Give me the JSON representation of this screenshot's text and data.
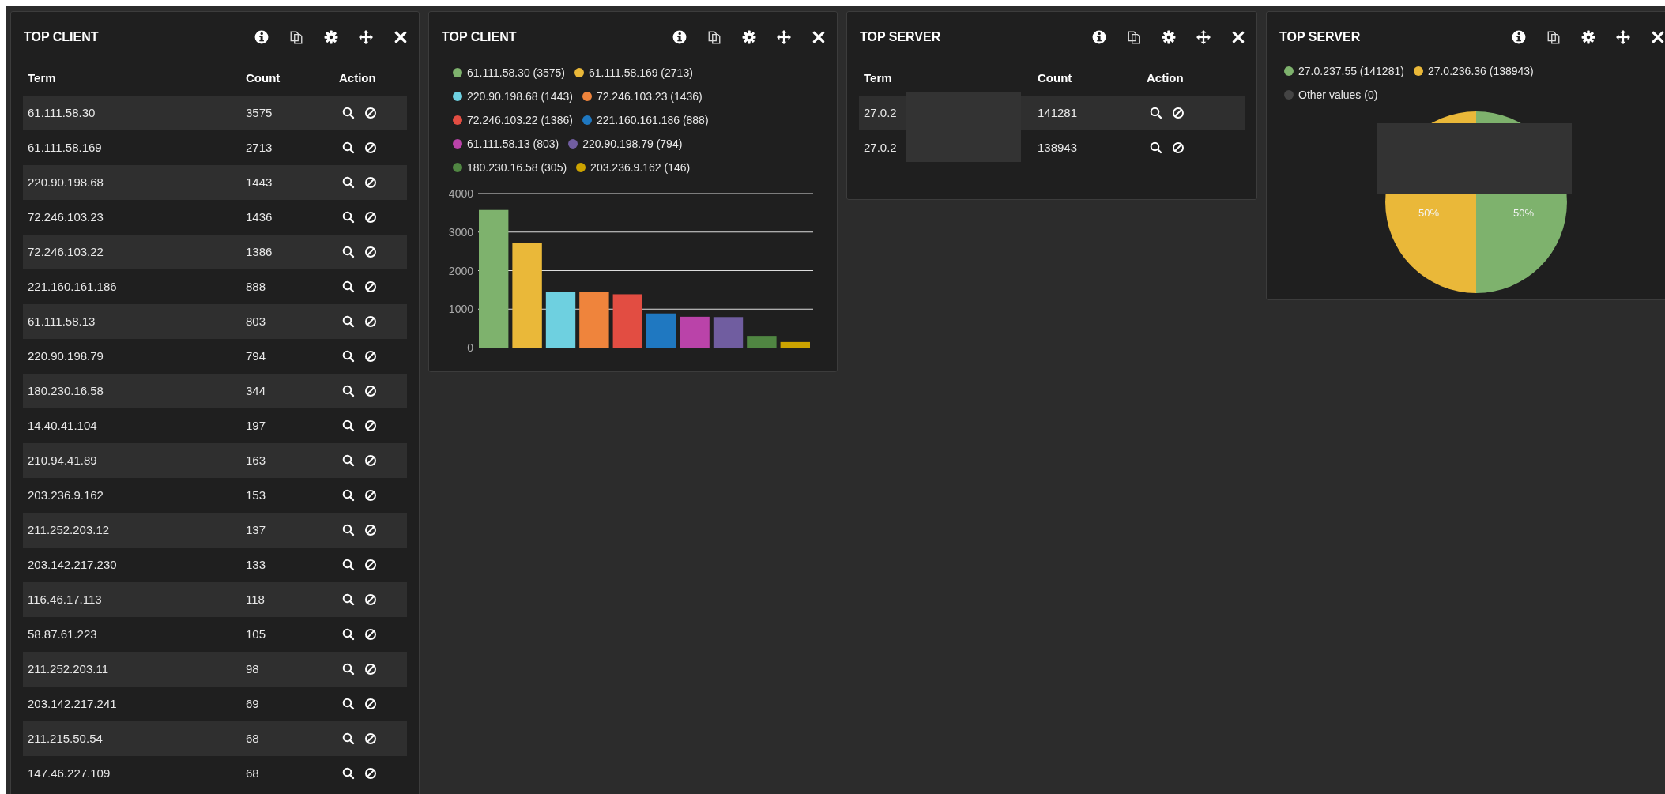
{
  "panels": [
    {
      "kind": "table",
      "title": "TOP CLIENT",
      "columns": [
        "Term",
        "Count",
        "Action"
      ],
      "rows": [
        {
          "term": "61.111.58.30",
          "count": "3575"
        },
        {
          "term": "61.111.58.169",
          "count": "2713"
        },
        {
          "term": "220.90.198.68",
          "count": "1443"
        },
        {
          "term": "72.246.103.23",
          "count": "1436"
        },
        {
          "term": "72.246.103.22",
          "count": "1386"
        },
        {
          "term": "221.160.161.186",
          "count": "888"
        },
        {
          "term": "61.111.58.13",
          "count": "803"
        },
        {
          "term": "220.90.198.79",
          "count": "794"
        },
        {
          "term": "180.230.16.58",
          "count": "344"
        },
        {
          "term": "14.40.41.104",
          "count": "197"
        },
        {
          "term": "210.94.41.89",
          "count": "163"
        },
        {
          "term": "203.236.9.162",
          "count": "153"
        },
        {
          "term": "211.252.203.12",
          "count": "137"
        },
        {
          "term": "203.142.217.230",
          "count": "133"
        },
        {
          "term": "116.46.17.113",
          "count": "118"
        },
        {
          "term": "58.87.61.223",
          "count": "105"
        },
        {
          "term": "211.252.203.11",
          "count": "98"
        },
        {
          "term": "203.142.217.241",
          "count": "69"
        },
        {
          "term": "211.215.50.54",
          "count": "68"
        },
        {
          "term": "147.46.227.109",
          "count": "68"
        }
      ]
    },
    {
      "kind": "chart",
      "title": "TOP CLIENT",
      "legend": [
        {
          "label": "61.111.58.30 (3575)",
          "color": "#7eb26d"
        },
        {
          "label": "61.111.58.169 (2713)",
          "color": "#eab839"
        },
        {
          "label": "220.90.198.68 (1443)",
          "color": "#6ed0e0"
        },
        {
          "label": "72.246.103.23 (1436)",
          "color": "#ef843c"
        },
        {
          "label": "72.246.103.22 (1386)",
          "color": "#e24d42"
        },
        {
          "label": "221.160.161.186 (888)",
          "color": "#1f78c1"
        },
        {
          "label": "61.111.58.13 (803)",
          "color": "#ba43a9"
        },
        {
          "label": "220.90.198.79 (794)",
          "color": "#705da0"
        },
        {
          "label": "180.230.16.58 (305)",
          "color": "#508642"
        },
        {
          "label": "203.236.9.162 (146)",
          "color": "#cca300"
        }
      ],
      "chart_data": {
        "type": "bar",
        "values": [
          3575,
          2713,
          1443,
          1436,
          1386,
          888,
          803,
          794,
          305,
          146
        ],
        "ylim": [
          0,
          4000
        ],
        "yticks": [
          0,
          1000,
          2000,
          3000,
          4000
        ],
        "grid": true
      }
    },
    {
      "kind": "table",
      "title": "TOP SERVER",
      "columns": [
        "Term",
        "Count",
        "Action"
      ],
      "rows": [
        {
          "term": "27.0.2",
          "count": "141281",
          "redacted": true
        },
        {
          "term": "27.0.2",
          "count": "138943",
          "redacted": true
        }
      ]
    },
    {
      "kind": "chart",
      "title": "TOP SERVER",
      "redacted": true,
      "legend": [
        {
          "label": "27.0.237.55 (141281)",
          "color": "#7eb26d"
        },
        {
          "label": "27.0.236.36 (138943)",
          "color": "#eab839"
        },
        {
          "label": "Other values (0)",
          "color": "#444444"
        }
      ],
      "chart_data": {
        "type": "pie",
        "values": [
          50,
          50,
          0
        ],
        "value_labels": [
          "50%",
          "50%",
          null
        ]
      }
    }
  ]
}
